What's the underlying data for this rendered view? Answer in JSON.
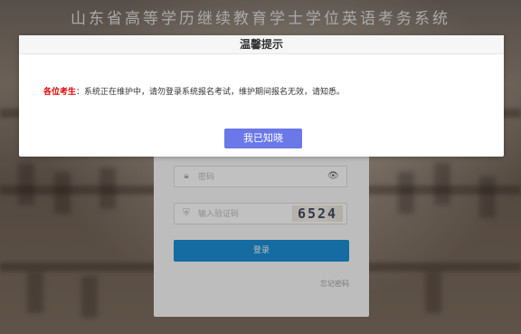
{
  "site": {
    "title": "山东省高等学历继续教育学士学位英语考务系统"
  },
  "login": {
    "password_placeholder": "密码",
    "captcha_placeholder": "输入验证码",
    "captcha_code": "6524",
    "login_label": "登录",
    "forgot_label": "忘记密码",
    "icons": {
      "password": "lock-icon",
      "toggle": "eye-icon",
      "captcha": "shield-icon"
    }
  },
  "modal": {
    "title": "温馨提示",
    "lead": "各位考生",
    "separator": "：",
    "message": "系统正在维护中，请勿登录系统报名考试，维护期间报名无效，请知悉。",
    "confirm_label": "我已知晓"
  },
  "colors": {
    "login_button": "#1a8bd0",
    "confirm_button": "#6a78e8",
    "lead_text": "#e00000"
  }
}
